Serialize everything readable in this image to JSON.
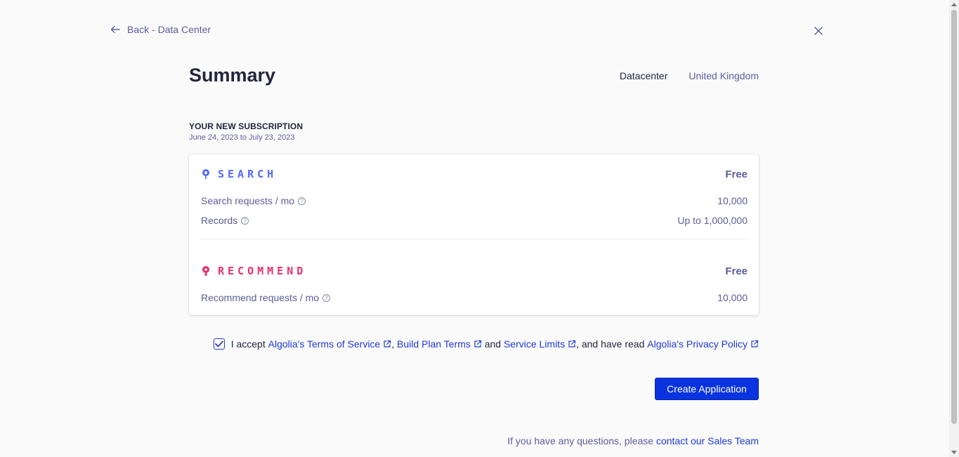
{
  "nav": {
    "back_label": "Back - Data Center"
  },
  "header": {
    "title": "Summary",
    "datacenter_label": "Datacenter",
    "datacenter_value": "United Kingdom"
  },
  "subscription": {
    "heading": "YOUR NEW SUBSCRIPTION",
    "dates": "June 24, 2023 to July 23, 2023"
  },
  "products": {
    "search": {
      "name": "SEARCH",
      "price": "Free",
      "color": "#5468ff",
      "rows": [
        {
          "label": "Search requests / mo",
          "value": "10,000"
        },
        {
          "label": "Records",
          "value": "Up to 1,000,000"
        }
      ]
    },
    "recommend": {
      "name": "RECOMMEND",
      "price": "Free",
      "color": "#e8306b",
      "rows": [
        {
          "label": "Recommend requests / mo",
          "value": "10,000"
        }
      ]
    }
  },
  "terms": {
    "prefix": "I accept",
    "tos": "Algolia's Terms of Service",
    "sep1": ",",
    "build_terms": "Build Plan Terms",
    "and": "and",
    "limits": "Service Limits",
    "read": ", and have read",
    "privacy": "Algolia's Privacy Policy",
    "checked": true
  },
  "actions": {
    "create_label": "Create Application"
  },
  "footer": {
    "text": "If you have any questions, please",
    "link": "contact our Sales Team"
  },
  "colors": {
    "accent": "#0a33e0",
    "link": "#1f3ad6",
    "muted": "#5a5e9a"
  }
}
